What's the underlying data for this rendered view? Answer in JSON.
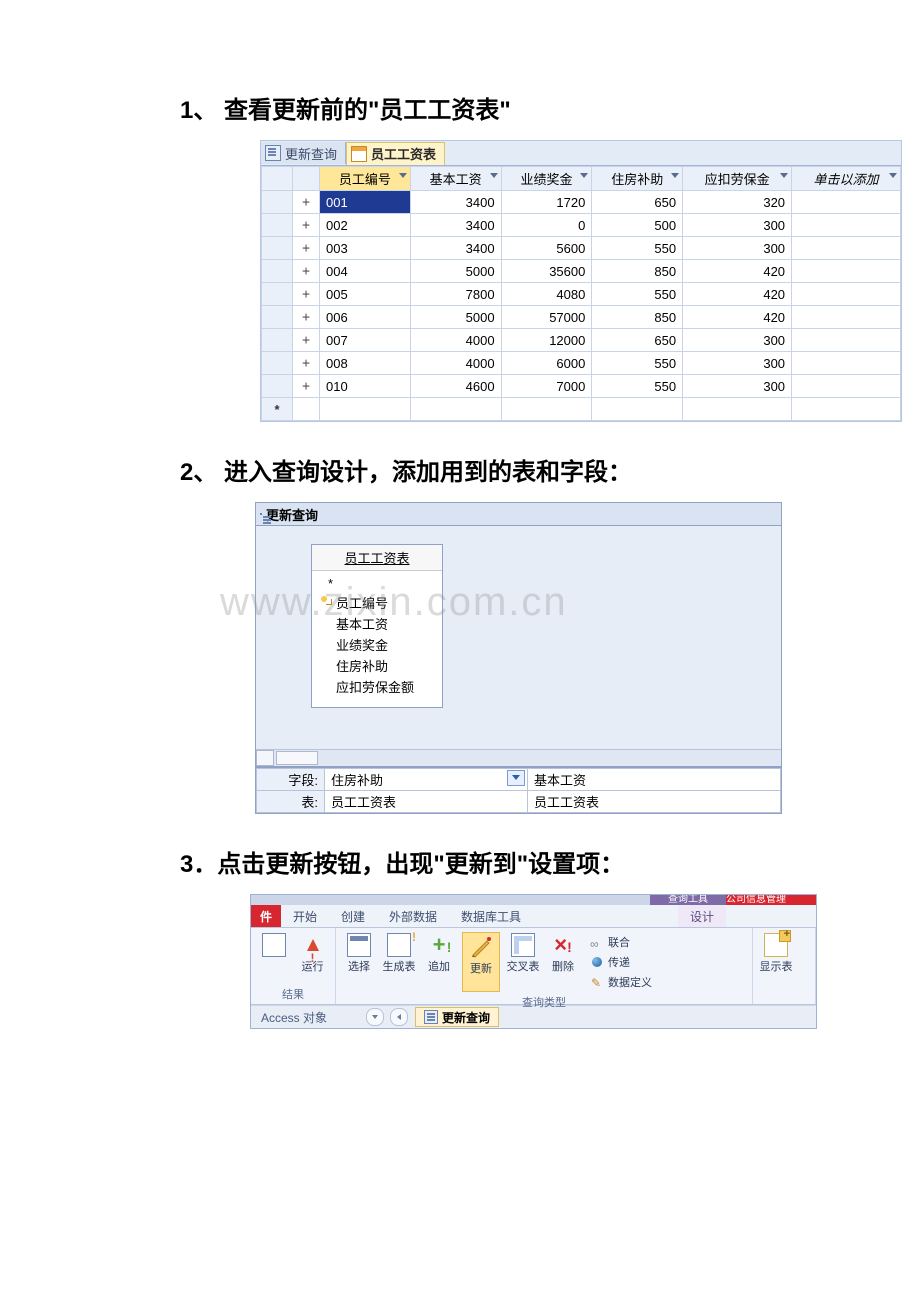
{
  "watermark": "www.zixin.com.cn",
  "headings": {
    "h1": "1、 查看更新前的\"员工工资表\"",
    "h2": "2、 进入查询设计，添加用到的表和字段：",
    "h3": "3．点击更新按钮，出现\"更新到\"设置项："
  },
  "fig1": {
    "tab_inactive": "更新查询",
    "tab_active": "员工工资表",
    "columns": [
      "员工编号",
      "基本工资",
      "业绩奖金",
      "住房补助",
      "应扣劳保金",
      "单击以添加"
    ],
    "rows": [
      {
        "id": "001",
        "c1": "3400",
        "c2": "1720",
        "c3": "650",
        "c4": "320"
      },
      {
        "id": "002",
        "c1": "3400",
        "c2": "0",
        "c3": "500",
        "c4": "300"
      },
      {
        "id": "003",
        "c1": "3400",
        "c2": "5600",
        "c3": "550",
        "c4": "300"
      },
      {
        "id": "004",
        "c1": "5000",
        "c2": "35600",
        "c3": "850",
        "c4": "420"
      },
      {
        "id": "005",
        "c1": "7800",
        "c2": "4080",
        "c3": "550",
        "c4": "420"
      },
      {
        "id": "006",
        "c1": "5000",
        "c2": "57000",
        "c3": "850",
        "c4": "420"
      },
      {
        "id": "007",
        "c1": "4000",
        "c2": "12000",
        "c3": "650",
        "c4": "300"
      },
      {
        "id": "008",
        "c1": "4000",
        "c2": "6000",
        "c3": "550",
        "c4": "300"
      },
      {
        "id": "010",
        "c1": "4600",
        "c2": "7000",
        "c3": "550",
        "c4": "300"
      }
    ],
    "new_marker": "*",
    "expand_marker": "+"
  },
  "fig2": {
    "title": "更新查询",
    "table_title": "员工工资表",
    "fields": [
      "*",
      "员工编号",
      "基本工资",
      "业绩奖金",
      "住房补助",
      "应扣劳保金额"
    ],
    "grid": {
      "label_field": "字段:",
      "label_table": "表:",
      "col1_field": "住房补助",
      "col1_table": "员工工资表",
      "col2_field": "基本工资",
      "col2_table": "员工工资表"
    }
  },
  "fig3": {
    "context_strip": "查询工具",
    "red_strip": "公司信息管理",
    "tabs": {
      "file": "件",
      "start": "开始",
      "create": "创建",
      "external": "外部数据",
      "dbtools": "数据库工具",
      "design": "设计"
    },
    "group_results_label": "结果",
    "group_querytype_label": "查询类型",
    "btn_view": "",
    "btn_run": "运行",
    "btn_select": "选择",
    "btn_make": "生成表",
    "btn_append": "追加",
    "btn_update": "更新",
    "btn_cross": "交叉表",
    "btn_delete": "删除",
    "btn_union": "联合",
    "btn_pass": "传递",
    "btn_ddl": "数据定义",
    "btn_show": "显示表",
    "nav_label": "Access 对象",
    "nav_tab": "更新查询"
  }
}
